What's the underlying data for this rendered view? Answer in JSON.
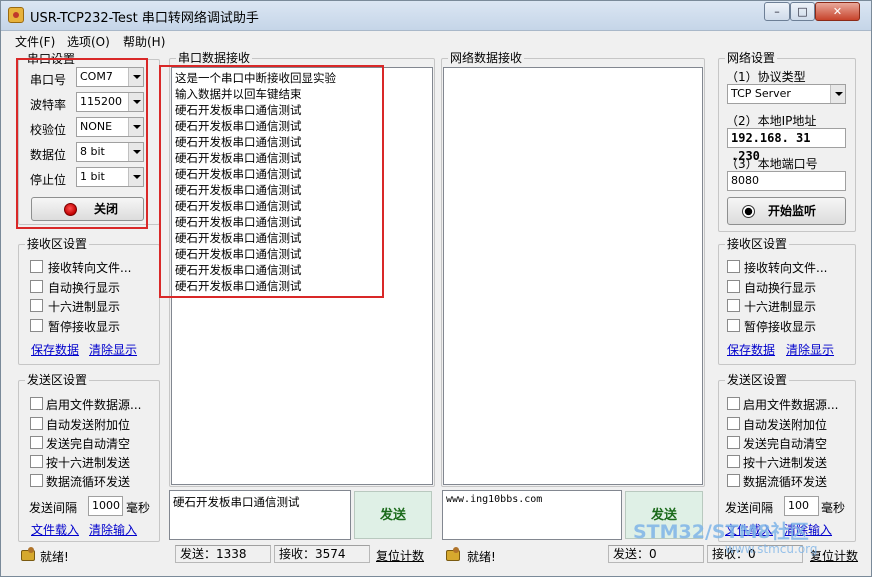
{
  "window": {
    "title": "USR-TCP232-Test 串口转网络调试助手",
    "btn_min": "–",
    "btn_max": "□",
    "btn_close": "✕"
  },
  "menu": [
    "文件(F)",
    "选项(O)",
    "帮助(H)"
  ],
  "serial_settings": {
    "title": "串口设置",
    "port_label": "串口号",
    "port_value": "COM7",
    "baud_label": "波特率",
    "baud_value": "115200",
    "parity_label": "校验位",
    "parity_value": "NONE",
    "databits_label": "数据位",
    "databits_value": "8 bit",
    "stopbits_label": "停止位",
    "stopbits_value": "1 bit",
    "close_button": "关闭"
  },
  "serial_recv_settings": {
    "title": "接收区设置",
    "options": [
      "接收转向文件...",
      "自动换行显示",
      "十六进制显示",
      "暂停接收显示"
    ],
    "save_link": "保存数据",
    "clear_link": "清除显示"
  },
  "serial_send_settings": {
    "title": "发送区设置",
    "options": [
      "启用文件数据源...",
      "自动发送附加位",
      "发送完自动清空",
      "按十六进制发送",
      "数据流循环发送"
    ],
    "interval_label": "发送间隔",
    "interval_value": "1000",
    "interval_unit": "毫秒",
    "load_link": "文件载入",
    "clear_link": "清除输入"
  },
  "serial_recv": {
    "title": "串口数据接收",
    "lines": [
      "这是一个串口中断接收回显实验",
      "输入数据并以回车键结束",
      "硬石开发板串口通信测试",
      "硬石开发板串口通信测试",
      "硬石开发板串口通信测试",
      "硬石开发板串口通信测试",
      "硬石开发板串口通信测试",
      "硬石开发板串口通信测试",
      "硬石开发板串口通信测试",
      "硬石开发板串口通信测试",
      "硬石开发板串口通信测试",
      "硬石开发板串口通信测试",
      "硬石开发板串口通信测试",
      "硬石开发板串口通信测试"
    ]
  },
  "serial_send": {
    "input_value": "硬石开发板串口通信测试",
    "send_button": "发送"
  },
  "net_recv": {
    "title": "网络数据接收"
  },
  "net_send": {
    "input_value": "www.ing10bbs.com",
    "send_button": "发送"
  },
  "net_settings": {
    "title": "网络设置",
    "protocol_label": "（1）协议类型",
    "protocol_value": "TCP Server",
    "ip_label": "（2）本地IP地址",
    "ip_value": "192.168. 31 .230",
    "port_label": "（3）本地端口号",
    "port_value": "8080",
    "listen_button": "开始监听"
  },
  "net_recv_settings": {
    "title": "接收区设置",
    "options": [
      "接收转向文件...",
      "自动换行显示",
      "十六进制显示",
      "暂停接收显示"
    ],
    "save_link": "保存数据",
    "clear_link": "清除显示"
  },
  "net_send_settings": {
    "title": "发送区设置",
    "options": [
      "启用文件数据源...",
      "自动发送附加位",
      "发送完自动清空",
      "按十六进制发送",
      "数据流循环发送"
    ],
    "interval_label": "发送间隔",
    "interval_value": "100",
    "interval_unit": "毫秒",
    "load_link": "文件载入",
    "clear_link": "清除输入"
  },
  "status_left": {
    "ready": "就绪!",
    "sent": "发送：1338",
    "recv": "接收：3574",
    "reset": "复位计数"
  },
  "status_right": {
    "ready": "就绪!",
    "sent": "发送：0",
    "recv": "接收：0",
    "reset": "复位计数"
  },
  "watermark": {
    "main": "STM32/STM8社区",
    "sub": "www.stmcu.org"
  },
  "colors": {
    "highlight": "#d92828",
    "link": "#0000cc",
    "send_button_text": "#1a6a1a"
  }
}
